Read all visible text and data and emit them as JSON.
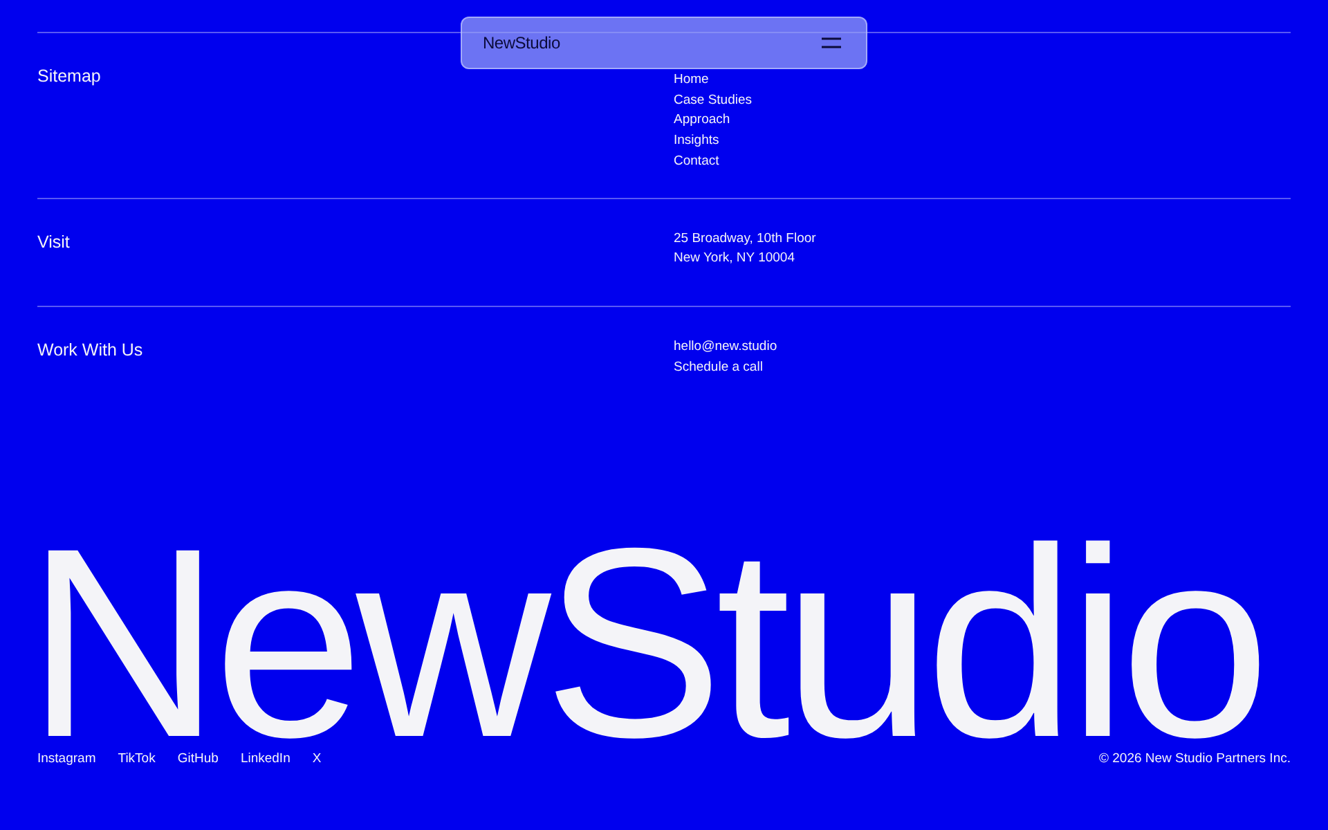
{
  "nav": {
    "logo": "NewStudio"
  },
  "sections": [
    {
      "label": "Sitemap",
      "links": [
        "Home",
        "Case Studies",
        "Approach",
        "Insights",
        "Contact"
      ]
    },
    {
      "label": "Visit",
      "links": [
        "25 Broadway, 10th Floor",
        "New York, NY 10004"
      ]
    },
    {
      "label": "Work With Us",
      "links": [
        "hello@new.studio",
        "Schedule a call"
      ]
    }
  ],
  "wordmark": "NewStudio",
  "social": [
    "Instagram",
    "TikTok",
    "GitHub",
    "LinkedIn",
    "X"
  ],
  "copyright": "© 2026 New Studio Partners Inc."
}
